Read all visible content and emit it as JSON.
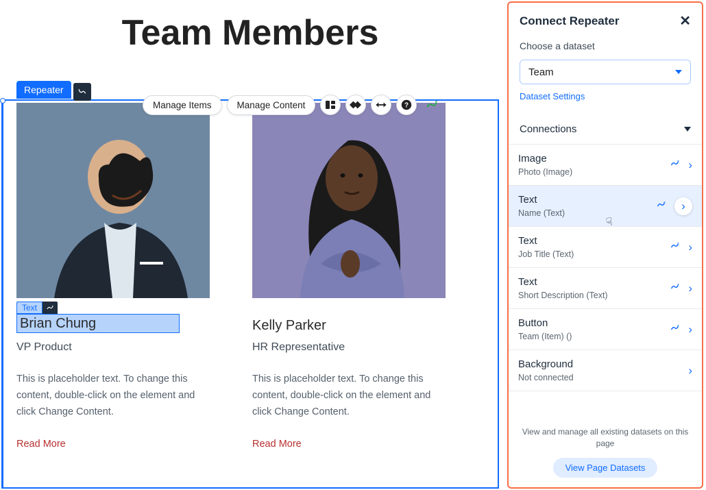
{
  "page": {
    "title": "Team Members"
  },
  "editor": {
    "selected_container_label": "Repeater",
    "selected_text_label": "Text",
    "toolbar": {
      "manage_items": "Manage Items",
      "manage_content": "Manage Content",
      "icons": [
        "layout-icon",
        "layers-icon",
        "stretch-icon",
        "help-icon",
        "connect-icon"
      ]
    }
  },
  "team": [
    {
      "name": "Brian Chung",
      "job": "VP Product",
      "desc": "This is placeholder text. To change this content, double-click on the element and click Change Content.",
      "cta": "Read More"
    },
    {
      "name": "Kelly Parker",
      "job": "HR Representative",
      "desc": "This is placeholder text. To change this content, double-click on the element and click Change Content.",
      "cta": "Read More"
    }
  ],
  "panel": {
    "title": "Connect Repeater",
    "choose_label": "Choose a dataset",
    "selected_dataset": "Team",
    "dataset_settings": "Dataset Settings",
    "connections_header": "Connections",
    "connections": [
      {
        "title": "Image",
        "sub": "Photo (Image)",
        "connected": true,
        "hover": false
      },
      {
        "title": "Text",
        "sub": "Name (Text)",
        "connected": true,
        "hover": true
      },
      {
        "title": "Text",
        "sub": "Job Title (Text)",
        "connected": true,
        "hover": false
      },
      {
        "title": "Text",
        "sub": "Short Description (Text)",
        "connected": true,
        "hover": false
      },
      {
        "title": "Button",
        "sub": "Team (Item) ()",
        "connected": true,
        "hover": false
      },
      {
        "title": "Background",
        "sub": "Not connected",
        "connected": false,
        "hover": false
      }
    ],
    "footer_text": "View and manage all existing datasets on this page",
    "footer_button": "View Page Datasets"
  }
}
